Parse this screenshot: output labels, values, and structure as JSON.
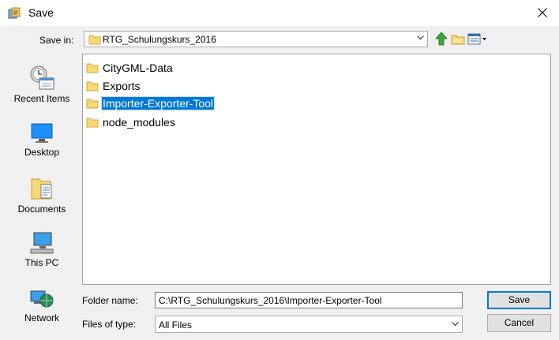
{
  "window": {
    "title": "Save",
    "icons": {
      "app": "java-app-icon",
      "close": "close-icon"
    }
  },
  "save_in": {
    "label": "Save in:",
    "value": "RTG_Schulungskurs_2016",
    "value_icon": "folder-icon"
  },
  "toolbar": {
    "buttons": [
      {
        "name": "up-one-level-button",
        "icon": "green-up-arrow-icon"
      },
      {
        "name": "create-new-folder-button",
        "icon": "new-folder-icon"
      },
      {
        "name": "view-menu-button",
        "icon": "details-view-icon"
      }
    ]
  },
  "places": [
    {
      "label": "Recent Items",
      "icon": "recent-items-icon"
    },
    {
      "label": "Desktop",
      "icon": "desktop-icon"
    },
    {
      "label": "Documents",
      "icon": "documents-icon"
    },
    {
      "label": "This PC",
      "icon": "computer-icon"
    },
    {
      "label": "Network",
      "icon": "network-icon"
    }
  ],
  "files": [
    {
      "label": "CityGML-Data",
      "selected": false
    },
    {
      "label": "Exports",
      "selected": false
    },
    {
      "label": "Importer-Exporter-Tool",
      "selected": true
    },
    {
      "label": "node_modules",
      "selected": false
    }
  ],
  "folder_name": {
    "label": "Folder name:",
    "value": "C:\\RTG_Schulungskurs_2016\\Importer-Exporter-Tool"
  },
  "files_of_type": {
    "label": "Files of type:",
    "value": "All Files"
  },
  "buttons": {
    "save": "Save",
    "cancel": "Cancel"
  },
  "colors": {
    "selection": "#0078d7",
    "dialog_bg": "#f0f0f0",
    "folder_yellow": "#f8d775"
  }
}
